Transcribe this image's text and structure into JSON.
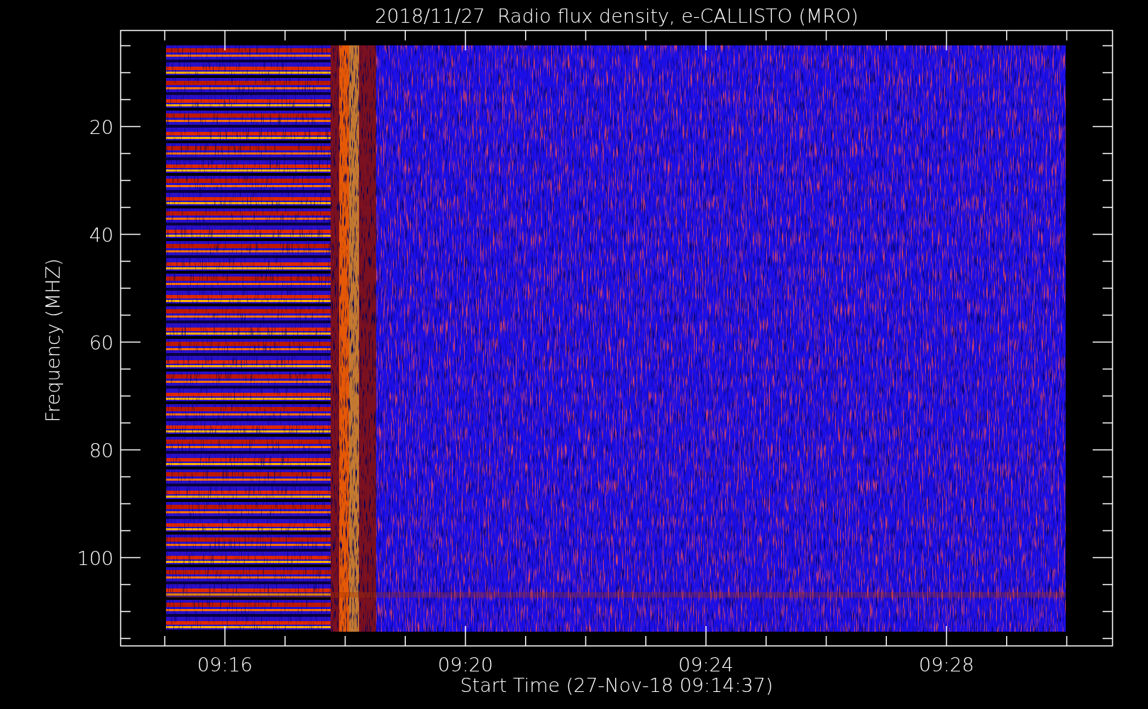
{
  "title": "2018/11/27  Radio flux density, e-CALLISTO (MRO)",
  "y_axis": {
    "label": "Frequency (MHZ)",
    "ticks": [
      "20",
      "40",
      "60",
      "80",
      "100"
    ]
  },
  "x_axis": {
    "label": "Start Time (27-Nov-18 09:14:37)",
    "ticks": [
      "09:16",
      "09:20",
      "09:24",
      "09:28"
    ]
  }
}
